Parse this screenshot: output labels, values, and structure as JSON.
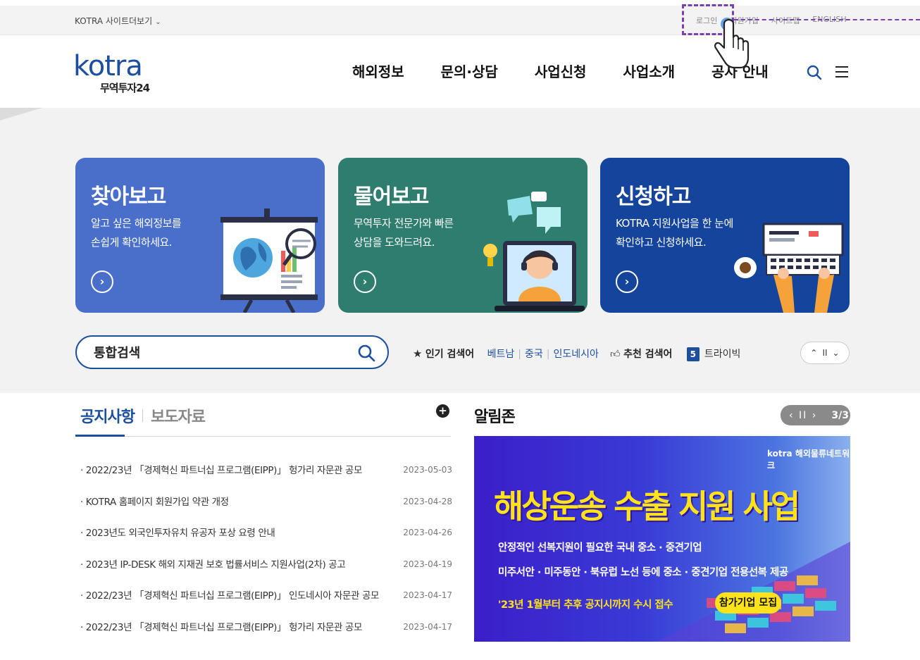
{
  "util": {
    "sites_toggle": "KOTRA 사이트더보기",
    "links": [
      "로그인",
      "회원가입",
      "사이트맵",
      "ENGLISH"
    ]
  },
  "header": {
    "logo_main": "kotra",
    "logo_sub": "무역투자24",
    "nav": [
      "해외정보",
      "문의·상담",
      "사업신청",
      "사업소개",
      "공사 안내"
    ]
  },
  "cards": [
    {
      "title": "찾아보고",
      "desc1": "알고 싶은 해외정보를",
      "desc2": "손쉽게 확인하세요.",
      "color": "#4a6fcb"
    },
    {
      "title": "물어보고",
      "desc1": "무역투자 전문가와 빠른",
      "desc2": "상담을 도와드려요.",
      "color": "#2e7d6e"
    },
    {
      "title": "신청하고",
      "desc1": "KOTRA 지원사업을 한 눈에",
      "desc2": "확인하고 신청하세요.",
      "color": "#15449c"
    }
  ],
  "search": {
    "value": "통합검색",
    "popular_label": "인기 검색어",
    "popular_keywords": [
      "베트남",
      "중국",
      "인도네시아"
    ],
    "recommend_label": "추천 검색어",
    "recommend_rank": "5",
    "recommend_keyword": "트라이빅"
  },
  "notice": {
    "tab_active": "공지사항",
    "tab_inactive": "보도자료",
    "items": [
      {
        "title": "· 2022/23년 「경제혁신 파트너십 프로그램(EIPP)」 헝가리 자문관 공모",
        "date": "2023-05-03"
      },
      {
        "title": "· KOTRA 홈페이지 회원가입 약관 개정",
        "date": "2023-04-28"
      },
      {
        "title": "· 2023년도 외국인투자유치 유공자 포상 요령 안내",
        "date": "2023-04-26"
      },
      {
        "title": "· 2023년 IP-DESK 해외 지재권 보호 법률서비스 지원사업(2차) 공고",
        "date": "2023-04-19"
      },
      {
        "title": "· 2022/23년 「경제혁신 파트너십 프로그램(EIPP)」 인도네시아 자문관 공모",
        "date": "2023-04-17"
      },
      {
        "title": "· 2022/23년 「경제혁신 파트너십 프로그램(EIPP)」 헝가리 자문관 공모",
        "date": "2023-04-17"
      }
    ]
  },
  "alim": {
    "title": "알림존",
    "pager_controls": "‹ II ›",
    "pager_count": "3/3",
    "banner_logo": "kotra 해외물류네트워크",
    "banner_title": "해상운송 수출 지원 사업",
    "banner_line1": "안정적인 선복지원이 필요한 국내 중소 · 중견기업",
    "banner_line2": "미주서안 · 미주동안 · 북유럽 노선 등에 중소 · 중견기업 전용선복 제공",
    "banner_line3": "'23년 1월부터 추후 공지시까지 수시 접수",
    "banner_cta": "참가기업 모집"
  },
  "colors": {
    "brand_blue": "#1d4fa0",
    "highlight_purple": "#7a3fb5",
    "banner_yellow": "#ffe21a"
  }
}
